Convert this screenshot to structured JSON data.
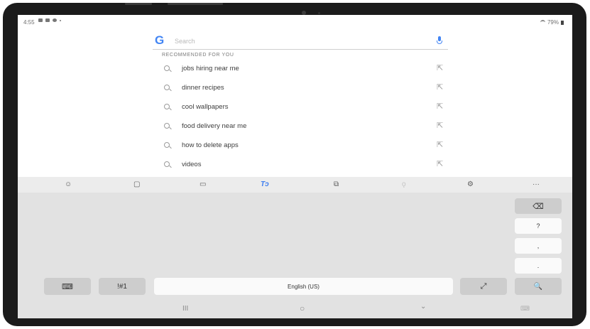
{
  "status_bar": {
    "time": "4:55",
    "battery": "79%"
  },
  "search": {
    "logo": "G",
    "placeholder": "Search"
  },
  "recommended_header": "RECOMMENDED FOR YOU",
  "suggestions": [
    "jobs hiring near me",
    "dinner recipes",
    "cool wallpapers",
    "food delivery near me",
    "how to delete apps",
    "videos"
  ],
  "keyboard": {
    "toolbar": [
      {
        "icon": "emoji-icon",
        "glyph": "☺"
      },
      {
        "icon": "sticker-icon",
        "glyph": "▢"
      },
      {
        "icon": "gif-icon",
        "glyph": "▭"
      },
      {
        "icon": "handwriting-icon",
        "glyph": "Tↄ"
      },
      {
        "icon": "clipboard-icon",
        "glyph": "⧉"
      },
      {
        "icon": "voice-input-icon",
        "glyph": "ǫ"
      },
      {
        "icon": "settings-icon",
        "glyph": "⚙"
      },
      {
        "icon": "more-icon",
        "glyph": "···"
      }
    ],
    "side_keys": {
      "backspace": "⌫",
      "question": "?",
      "comma": ",",
      "period": "."
    },
    "bottom_row": {
      "keyboard_switch": "⌨",
      "symbols": "!#1",
      "space": "English (US)",
      "expand": "⤢",
      "search": "🔍"
    }
  },
  "navigation": {
    "recents": "III",
    "home": "○",
    "back": "⌄",
    "keyboard_toggle": "⌨"
  },
  "colors": {
    "accent": "#3d7ef0",
    "keyboard_bg": "#e2e2e2"
  }
}
